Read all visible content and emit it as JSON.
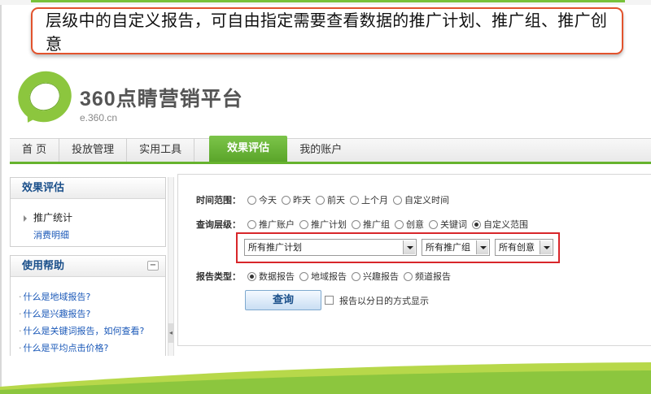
{
  "callout": {
    "text": "层级中的自定义报告，可自由指定需要查看数据的推广计划、推广组、推广创意"
  },
  "logo": {
    "name": "360点睛营销平台",
    "url": "e.360.cn"
  },
  "nav": {
    "items": [
      {
        "label": "首 页"
      },
      {
        "label": "投放管理"
      },
      {
        "label": "实用工具"
      },
      {
        "label": "效果评估",
        "active": true
      },
      {
        "label": "我的账户"
      }
    ]
  },
  "sidebar": {
    "eval_title": "效果评估",
    "eval_item": "推广统计",
    "eval_sub": "消费明细",
    "help_title": "使用帮助",
    "help_collapse": "−",
    "help_links": [
      "什么是地域报告?",
      "什么是兴趣报告?",
      "什么是关键词报告，如何查看?",
      "什么是平均点击价格?"
    ]
  },
  "form": {
    "time_label": "时间范围：",
    "time_options": [
      "今天",
      "昨天",
      "前天",
      "上个月",
      "自定义时间"
    ],
    "level_label": "查询层级：",
    "level_options": [
      "推广账户",
      "推广计划",
      "推广组",
      "创意",
      "关键词",
      "自定义范围"
    ],
    "level_selected": "自定义范围",
    "select_plan": "所有推广计划",
    "select_group": "所有推广组",
    "select_creative": "所有创意",
    "type_label": "报告类型：",
    "type_options": [
      "数据报告",
      "地域报告",
      "兴趣报告",
      "频道报告"
    ],
    "type_selected": "数据报告",
    "query_button": "查询",
    "daily_checkbox_label": "报告以分日的方式显示"
  },
  "colors": {
    "accent_green": "#66b32e",
    "callout_border": "#e2532d",
    "highlight_red": "#d8262a",
    "link_blue": "#1a58b8"
  }
}
